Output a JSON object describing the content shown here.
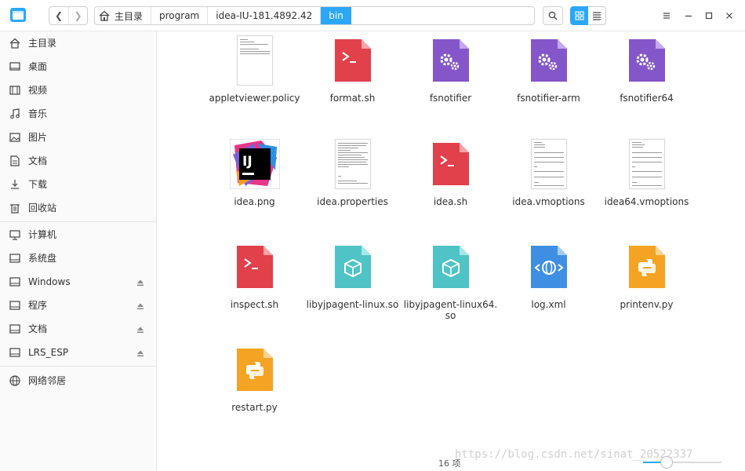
{
  "breadcrumb": {
    "items": [
      {
        "label": "主目录"
      },
      {
        "label": "program"
      },
      {
        "label": "idea-IU-181.4892.42"
      },
      {
        "label": "bin"
      }
    ]
  },
  "sidebar": {
    "items": [
      {
        "label": "主目录",
        "icon": "home-icon"
      },
      {
        "label": "桌面",
        "icon": "desktop-icon"
      },
      {
        "label": "视频",
        "icon": "video-icon"
      },
      {
        "label": "音乐",
        "icon": "music-icon"
      },
      {
        "label": "图片",
        "icon": "picture-icon"
      },
      {
        "label": "文档",
        "icon": "document-icon"
      },
      {
        "label": "下载",
        "icon": "download-icon"
      },
      {
        "label": "回收站",
        "icon": "trash-icon"
      }
    ],
    "devices": [
      {
        "label": "计算机",
        "icon": "computer-icon",
        "eject": false
      },
      {
        "label": "系统盘",
        "icon": "disk-icon",
        "eject": false
      },
      {
        "label": "Windows",
        "icon": "disk-icon",
        "eject": true
      },
      {
        "label": "程序",
        "icon": "disk-icon",
        "eject": true
      },
      {
        "label": "文档",
        "icon": "disk-icon",
        "eject": true
      },
      {
        "label": "LRS_ESP",
        "icon": "disk-icon",
        "eject": true
      }
    ],
    "network": {
      "label": "网络邻居",
      "icon": "network-icon"
    }
  },
  "files": [
    {
      "name": "appletviewer.policy",
      "type": "text"
    },
    {
      "name": "format.sh",
      "type": "shell"
    },
    {
      "name": "fsnotifier",
      "type": "executable"
    },
    {
      "name": "fsnotifier-arm",
      "type": "executable"
    },
    {
      "name": "fsnotifier64",
      "type": "executable"
    },
    {
      "name": "idea.png",
      "type": "image"
    },
    {
      "name": "idea.properties",
      "type": "text"
    },
    {
      "name": "idea.sh",
      "type": "shell"
    },
    {
      "name": "idea.vmoptions",
      "type": "text"
    },
    {
      "name": "idea64.vmoptions",
      "type": "text"
    },
    {
      "name": "inspect.sh",
      "type": "shell"
    },
    {
      "name": "libyjpagent-linux.so",
      "type": "library"
    },
    {
      "name": "libyjpagent-linux64.so",
      "type": "library"
    },
    {
      "name": "log.xml",
      "type": "xml"
    },
    {
      "name": "printenv.py",
      "type": "python"
    },
    {
      "name": "restart.py",
      "type": "python"
    }
  ],
  "status": {
    "count_label": "16 项"
  },
  "zoom": {
    "level": 0.3
  },
  "watermark": {
    "text": "https://blog.csdn.net/sinat_20522337"
  },
  "colors": {
    "accent": "#2ca7f8",
    "shell": "#e0414b",
    "executable": "#8456c9",
    "library": "#4fc3c6",
    "xml": "#3e8fe2",
    "python": "#f4a322",
    "idea_bg": "#000000"
  }
}
